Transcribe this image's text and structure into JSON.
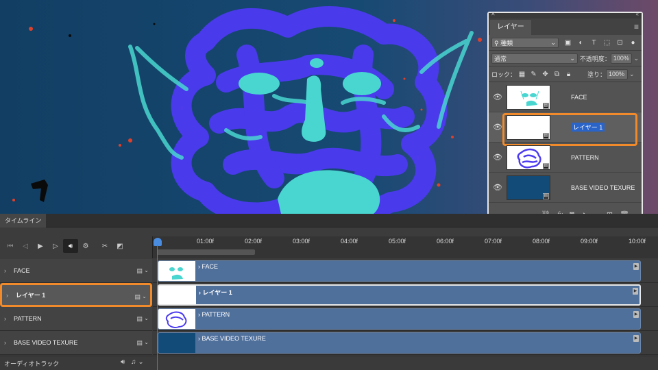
{
  "canvas": {
    "description_colors": {
      "background": "#113f66",
      "scribble": "#4b3af0",
      "face": "#49d6d0",
      "speckle": "#e0402a"
    }
  },
  "layers_panel": {
    "tab_label": "レイヤー",
    "filter_kind": "種類",
    "blend_mode": "通常",
    "opacity_label": "不透明度：",
    "opacity_value": "100%",
    "lock_label": "ロック：",
    "fill_label": "塗り：",
    "fill_value": "100%",
    "layers": [
      {
        "name": "FACE",
        "visible": true
      },
      {
        "name": "レイヤー 1",
        "visible": true,
        "selected": true
      },
      {
        "name": "PATTERN",
        "visible": true
      },
      {
        "name": "BASE VIDEO TEXURE",
        "visible": true
      }
    ]
  },
  "timeline": {
    "tab_label": "タイムライン",
    "ruler_labels": [
      "01:00f",
      "02:00f",
      "03:00f",
      "04:00f",
      "05:00f",
      "06:00f",
      "07:00f",
      "08:00f",
      "09:00f",
      "10:00f"
    ],
    "tracks": [
      {
        "name": "FACE",
        "clip_label": "FACE"
      },
      {
        "name": "レイヤー 1",
        "clip_label": "レイヤー 1",
        "selected": true
      },
      {
        "name": "PATTERN",
        "clip_label": "PATTERN"
      },
      {
        "name": "BASE VIDEO TEXURE",
        "clip_label": "BASE VIDEO TEXURE"
      }
    ],
    "audio_track_label": "オーディオトラック"
  }
}
